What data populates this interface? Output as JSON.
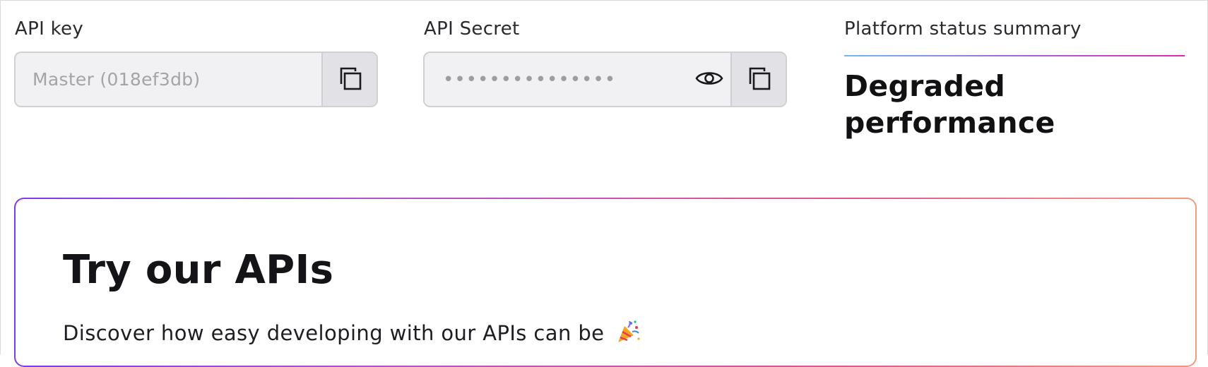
{
  "api_key": {
    "label": "API key",
    "placeholder": "Master (018ef3db)",
    "copy_icon": "copy-icon"
  },
  "api_secret": {
    "label": "API Secret",
    "masked_value": "•••••••••••••••",
    "reveal_icon": "eye-icon",
    "copy_icon": "copy-icon"
  },
  "platform_status": {
    "label": "Platform status summary",
    "value": "Degraded performance"
  },
  "try_apis": {
    "title": "Try our APIs",
    "description": "Discover how easy developing with our APIs can be",
    "emoji_icon": "party-popper-icon"
  },
  "colors": {
    "status_gradient": [
      "#6fb8f0",
      "#a266e0",
      "#e02aa5"
    ],
    "card_gradient": [
      "#7c3aed",
      "#b34fd0",
      "#e1568c",
      "#f49a7f"
    ]
  }
}
